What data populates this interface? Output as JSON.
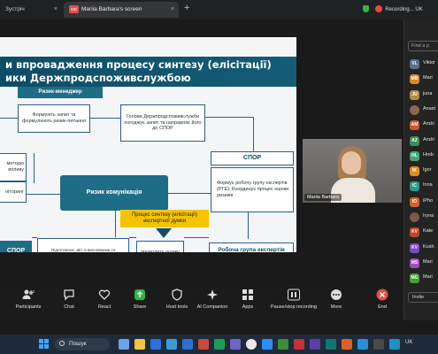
{
  "browser": {
    "tab1_label": "Зустріч",
    "tab2_label": "Mariia Barbara's screen",
    "tab2_badge": "MB",
    "recording_label": "Recording...",
    "lang": "UK"
  },
  "slide": {
    "title_line1": "и впровадження процесу синтезу (елісітації)",
    "title_line2": "ики Держпродспоживслужбою",
    "risk_manager_header": "Ризик-менеджер",
    "box_request": "Формують запит та формулюють ризик-питання",
    "box_head": "Голова Держпродспоживслужби погоджує запит та направляє його до СПОР",
    "box_method": "методю впливу",
    "box_monitoring": "ніторинг",
    "box_communication": "Ризик комунікація",
    "spor_header": "СПОР",
    "box_spor_tasks": "Формує робочу групу експертів (РГЕ); Координує процес оцінки ризиків",
    "box_synthesis": "Процес синтезу (елісітації) експертної думки",
    "box_report": "Підготовлює звіт із висновками та рекомендаціями за результатами проведеної оцінки ризиків та передає його СПОР",
    "box_assessment": "проводить оцінку ризиків",
    "box_spor_left": "СПОР",
    "box_working_group": "Робоча група експертів (РГЕ)"
  },
  "video": {
    "name": "Mariia Barbara"
  },
  "participants": {
    "search_placeholder": "Find a p",
    "invite_label": "Invite",
    "list": [
      {
        "initials": "VL",
        "name": "Viktor",
        "color": "#5b6f88",
        "photo": false
      },
      {
        "initials": "MB",
        "name": "Mari",
        "color": "#d08a30",
        "photo": false
      },
      {
        "initials": "JU",
        "name": "juna",
        "color": "#b58a4a",
        "photo": false
      },
      {
        "initials": "",
        "name": "Anast",
        "color": "#8a6a55",
        "photo": true
      },
      {
        "initials": "AM",
        "name": "Andri",
        "color": "#d2542d",
        "photo": false
      },
      {
        "initials": "AZ",
        "name": "Andri",
        "color": "#3b8f5a",
        "photo": false
      },
      {
        "initials": "HL",
        "name": "Hreb",
        "color": "#47a37a",
        "photo": false
      },
      {
        "initials": "IK",
        "name": "Igor",
        "color": "#e08a1e",
        "photo": false
      },
      {
        "initials": "IC",
        "name": "Inna",
        "color": "#2a9a8a",
        "photo": false
      },
      {
        "initials": "IO",
        "name": "iPho",
        "color": "#d0642a",
        "photo": false
      },
      {
        "initials": "",
        "name": "Iryna",
        "color": "#7a5a48",
        "photo": true
      },
      {
        "initials": "KV",
        "name": "Kate",
        "color": "#c0442a",
        "photo": false
      },
      {
        "initials": "KV",
        "name": "Kush",
        "color": "#7a4cc0",
        "photo": false
      },
      {
        "initials": "MS",
        "name": "Mari",
        "color": "#a04cc0",
        "photo": false
      },
      {
        "initials": "MG",
        "name": "Mari",
        "color": "#4c9a3e",
        "photo": false
      }
    ]
  },
  "toolbar": {
    "participants_label": "Participants",
    "participants_count": "32",
    "chat_label": "Chat",
    "react_label": "React",
    "share_label": "Share",
    "host_tools_label": "Host tools",
    "ai_label": "AI Companion",
    "apps_label": "Apps",
    "record_label": "Pause/stop recording",
    "more_label": "More",
    "end_label": "End"
  },
  "taskbar": {
    "search_label": "Пошук",
    "tray": "UK"
  },
  "colors": {
    "slide_header": "#0f4d67",
    "box_dark": "#1f6c86",
    "highlight": "#f5c400",
    "end_red": "#e0504a",
    "share_green": "#2fb34a"
  }
}
